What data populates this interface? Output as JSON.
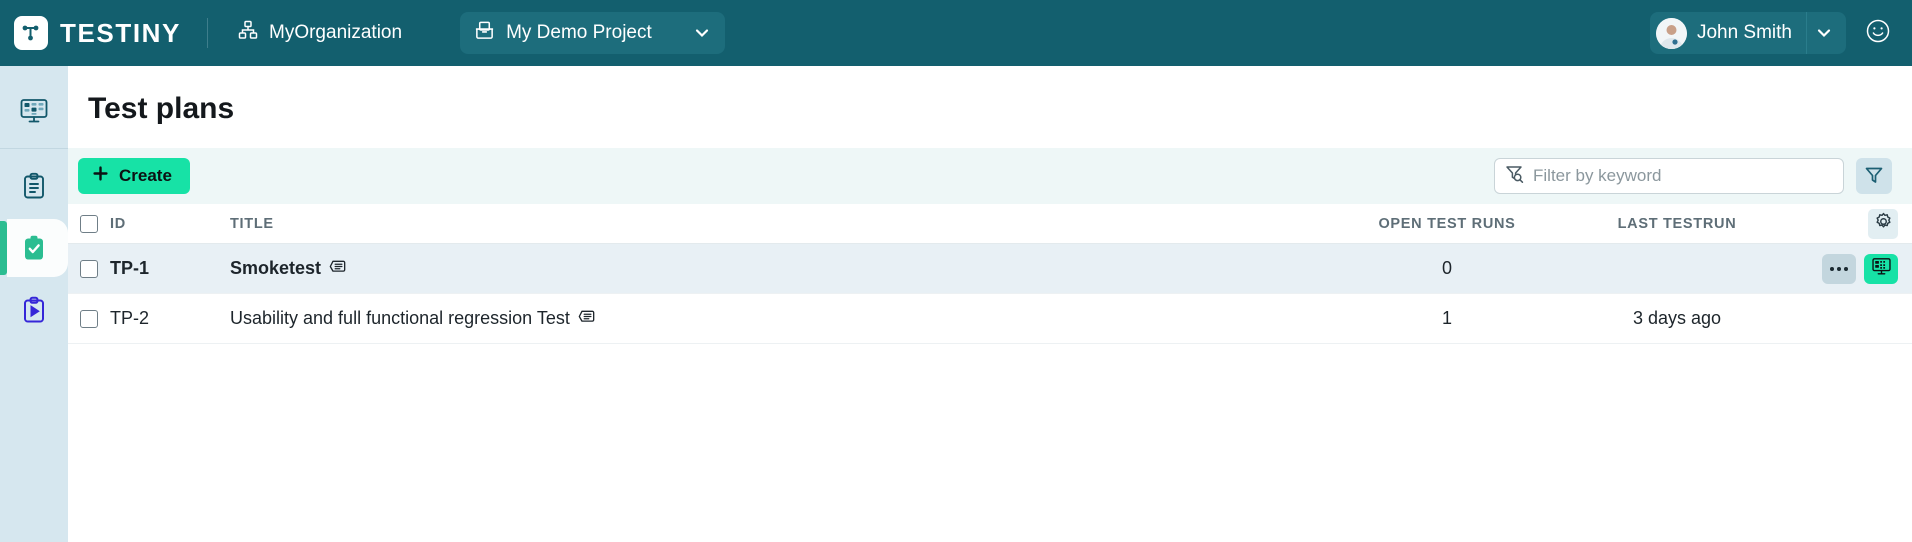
{
  "topbar": {
    "logo_text": "TESTINY",
    "logo_icon": "testiny-logo-icon",
    "org_icon": "organization-hierarchy-icon",
    "org_name": "MyOrganization",
    "project_icon": "project-box-icon",
    "project_name": "My Demo Project",
    "project_chevron_icon": "chevron-down-icon",
    "user_name": "John Smith",
    "user_avatar_icon": "avatar",
    "user_chevron_icon": "chevron-down-icon",
    "help_icon": "smiley-face-icon"
  },
  "sidebar": {
    "items": [
      {
        "name": "dashboard",
        "icon": "dashboard-monitor-icon",
        "active": false
      },
      {
        "name": "test-cases",
        "icon": "clipboard-lines-icon",
        "active": false
      },
      {
        "name": "test-plans",
        "icon": "clipboard-check-icon",
        "active": true
      },
      {
        "name": "test-runs",
        "icon": "clipboard-play-icon",
        "active": false
      }
    ]
  },
  "page": {
    "title": "Test plans"
  },
  "toolbar": {
    "create_label": "Create",
    "create_icon": "plus-icon",
    "create_color": "#17e2a6",
    "filter_icon": "filter-search-icon",
    "filter_placeholder": "Filter by keyword",
    "filter_value": "",
    "filter_button_icon": "filter-icon"
  },
  "table": {
    "columns": [
      {
        "key": "id",
        "label": "ID"
      },
      {
        "key": "title",
        "label": "TITLE"
      },
      {
        "key": "runs",
        "label": "OPEN TEST RUNS"
      },
      {
        "key": "last",
        "label": "LAST TESTRUN"
      }
    ],
    "settings_icon": "gear-icon",
    "select_all_checked": false,
    "rows": [
      {
        "id": "TP-1",
        "title": "Smoketest",
        "title_icon": "description-icon",
        "open_test_runs": "0",
        "last_testrun": "",
        "checked": false,
        "hovered": true,
        "actions": {
          "more_icon": "ellipsis-icon",
          "run_icon": "dashboard-monitor-icon",
          "run_color": "#17e2a6"
        }
      },
      {
        "id": "TP-2",
        "title": "Usability and full functional regression Test",
        "title_icon": "description-icon",
        "open_test_runs": "1",
        "last_testrun": "3 days ago",
        "checked": false,
        "hovered": false,
        "actions": null
      }
    ]
  }
}
